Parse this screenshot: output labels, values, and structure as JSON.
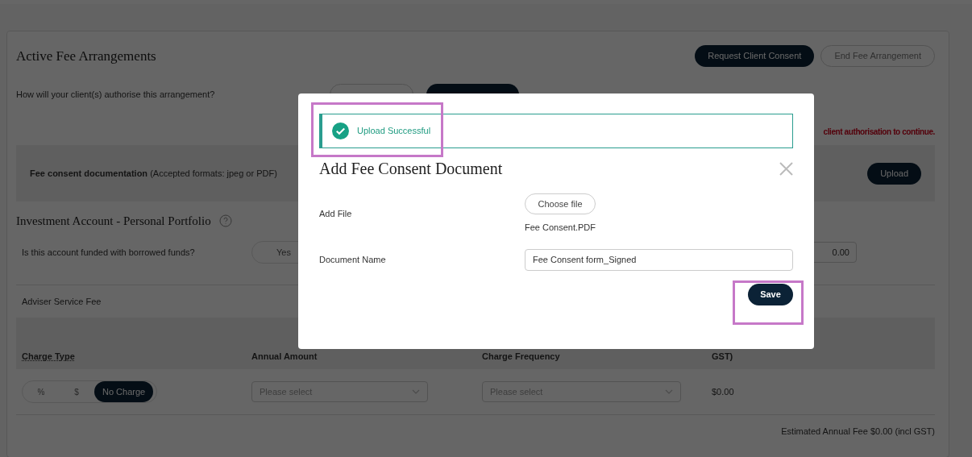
{
  "card": {
    "title": "Active Fee Arrangements",
    "actions": [
      {
        "label": "Request Client Consent",
        "kind": "primary"
      },
      {
        "label": "End Fee Arrangement",
        "kind": "outline"
      }
    ],
    "authorise": {
      "question": "How will your client(s) authorise this arrangement?",
      "options": [
        {
          "selected": false
        },
        {
          "selected": true
        }
      ]
    },
    "warning": "client authorisation to continue.",
    "documentation": {
      "text": "**Fee consent documentation** (Accepted formats: jpeg or PDF)",
      "button": "Upload"
    }
  },
  "account": {
    "title": "Investment Account - Personal Portfolio",
    "borrowed": {
      "question": "Is this account funded with borrowed funds?",
      "options": [
        {
          "label": "Yes",
          "selected": false
        }
      ],
      "amount": "0.00"
    },
    "fee_title": "Adviser Service Fee",
    "columns": [
      "Charge Type",
      "Annual Amount",
      "Charge Frequency",
      "GST)"
    ],
    "row": {
      "charge_types": [
        {
          "label": "%",
          "selected": false
        },
        {
          "label": "$",
          "selected": false
        },
        {
          "label": "No Charge",
          "selected": true
        }
      ],
      "annual_amount": {
        "placeholder": "Please select"
      },
      "frequency": {
        "placeholder": "Please select"
      },
      "fee": "$0.00"
    },
    "estimate": "Estimated Annual Fee $0.00 (incl GST)"
  },
  "modal": {
    "alert": {
      "text": "Upload Successful",
      "highlight": true
    },
    "title": "Add Fee Consent Document",
    "fields": [
      {
        "kind": "file",
        "label": "Add File",
        "button": "Choose file",
        "file_name": "Fee Consent.PDF"
      },
      {
        "kind": "text",
        "label": "Document Name",
        "value": "Fee Consent form_Signed"
      }
    ],
    "save": {
      "label": "Save",
      "highlight": true
    }
  }
}
